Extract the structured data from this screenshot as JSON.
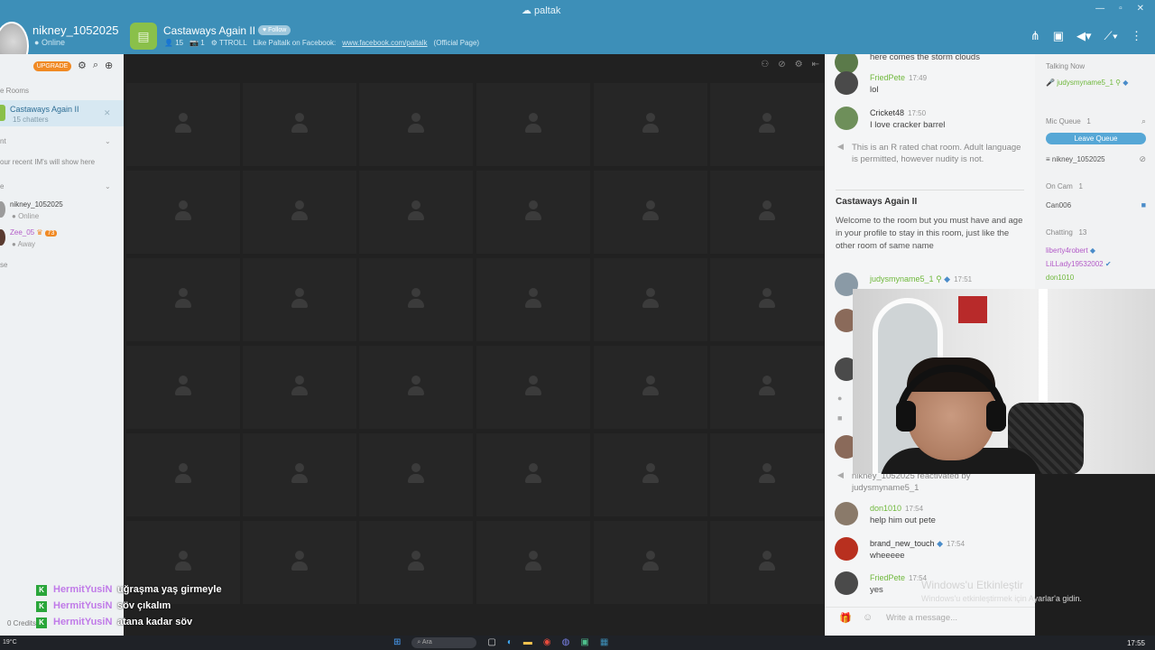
{
  "app": {
    "brand": "paltak"
  },
  "profile": {
    "username": "nikney_1052025",
    "status": "Online"
  },
  "room": {
    "title": "Castaways Again II",
    "follow_label": "Follow",
    "users": "15",
    "cams": "1",
    "troll": "TTROLL",
    "facebook_text": "Like Paltalk on Facebook:",
    "facebook_link": "www.facebook.com/paltalk",
    "official": "(Official Page)"
  },
  "sidebar": {
    "upgrade_label": "UPGRADE",
    "rooms_header": "e Rooms",
    "active_room_name": "Castaways Again II",
    "active_room_count": "15 chatters",
    "recent_header": "nt",
    "recent_empty": "our recent IM's will show here",
    "contacts_header": "e",
    "contacts": [
      {
        "name": "nikney_1052025",
        "status": "Online"
      },
      {
        "name": "Zee_05",
        "badge": "73",
        "status": "Away"
      }
    ],
    "footer_header": "se",
    "credits": "0 Credits"
  },
  "chat": {
    "messages_top": [
      {
        "user": "",
        "time": "",
        "text": "here comes the storm clouds"
      },
      {
        "user": "FriedPete",
        "time": "17:49",
        "text": "lol"
      },
      {
        "user": "Cricket48",
        "time": "17:50",
        "text": "I love cracker barrel"
      }
    ],
    "rules_notice": "This is an R rated chat room. Adult language is permitted, however nudity is not.",
    "welcome_title": "Castaways Again II",
    "welcome_body": "Welcome to the room but you must have and age in your profile to stay in this room, just like the other room of same name",
    "mid_message": {
      "user": "judysmyname5_1",
      "time": "17:51"
    },
    "reactivated_text": "nikney_1052025 reactivated by judysmyname5_1",
    "messages_bottom": [
      {
        "user": "don1010",
        "time": "17:54",
        "text": "help him out pete"
      },
      {
        "user": "brand_new_touch",
        "time": "17:54",
        "text": "wheeeee"
      },
      {
        "user": "FriedPete",
        "time": "17:54",
        "text": "yes"
      }
    ],
    "input_placeholder": "Write a message..."
  },
  "userlist": {
    "talking_now_header": "Talking Now",
    "talking_now_user": "judysmyname5_1",
    "mic_queue_header": "Mic Queue",
    "mic_queue_count": "1",
    "leave_queue_label": "Leave Queue",
    "mic_queue_user": "nikney_1052025",
    "on_cam_header": "On Cam",
    "on_cam_count": "1",
    "on_cam_user": "Can006",
    "chatting_header": "Chatting",
    "chatting_count": "13",
    "chatting_users": [
      "liberty4robert",
      "LiLLady19532002",
      "don1010"
    ]
  },
  "stream_overlay": {
    "lines": [
      {
        "user": "HermitYusiN",
        "text": "uğraşma yaş girmeyle"
      },
      {
        "user": "HermitYusiN",
        "text": "söv çıkalım"
      },
      {
        "user": "HermitYusiN",
        "text": "atana kadar söv"
      }
    ]
  },
  "watermark": {
    "title": "Windows'u Etkinleştir",
    "subtitle": "Windows'u etkinleştirmek için Ayarlar'a gidin."
  },
  "taskbar": {
    "weather": "19°C",
    "search": "Ara",
    "time": "17:55"
  }
}
